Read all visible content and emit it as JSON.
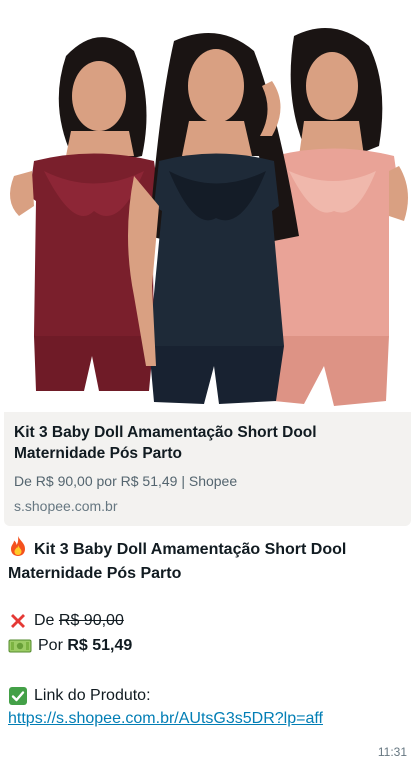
{
  "message": {
    "image": {
      "alt": "Kit 3 Baby Doll Amamentação",
      "colors": {
        "wine": "#7a1f2c",
        "navy": "#1e2a38",
        "rose": "#e9a397",
        "skin": "#d9a082",
        "hair": "#1a1413"
      }
    },
    "preview": {
      "title": "Kit 3 Baby Doll Amamentação Short Dool Maternidade Pós Parto",
      "description": "De R$ 90,00 por R$ 51,49 | Shopee",
      "domain": "s.shopee.com.br",
      "background": "#f3f2f0"
    },
    "body": {
      "title": "Kit 3 Baby Doll Amamentação Short Dool Maternidade Pós Parto",
      "from_label": "De",
      "from_price": "R$ 90,00",
      "to_label": "Por",
      "to_price": "R$ 51,49",
      "link_label": "Link do Produto:",
      "link_url": "https://s.shopee.com.br/AUtsG3s5DR?lp=aff",
      "icons": [
        "fire-icon",
        "cross-mark-icon",
        "banknote-icon",
        "check-mark-icon"
      ]
    },
    "timestamp": "11:31",
    "link_color": "#027eb5"
  }
}
